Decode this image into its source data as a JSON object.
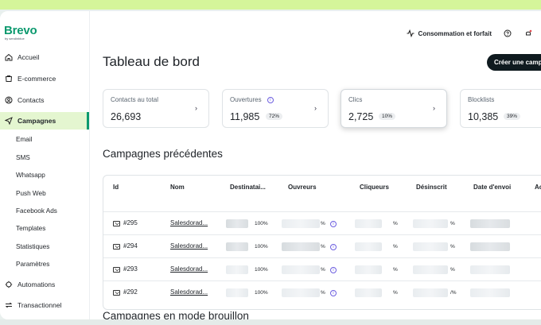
{
  "brand": {
    "name": "Brevo",
    "sub": "by sendinblue"
  },
  "sidebar": {
    "items": [
      {
        "label": "Accueil",
        "icon": "home-icon"
      },
      {
        "label": "E-commerce",
        "icon": "cart-icon"
      },
      {
        "label": "Contacts",
        "icon": "contacts-icon"
      },
      {
        "label": "Campagnes",
        "icon": "send-icon",
        "active": true
      }
    ],
    "subitems": [
      "Email",
      "SMS",
      "Whatsapp",
      "Push Web",
      "Facebook Ads",
      "Templates",
      "Statistiques",
      "Paramètres"
    ],
    "bottom_items": [
      {
        "label": "Automations",
        "icon": "automation-icon"
      },
      {
        "label": "Transactionnel",
        "icon": "transactional-icon"
      }
    ]
  },
  "header": {
    "consumption_label": "Consommation et forfait"
  },
  "page": {
    "title": "Tableau de bord",
    "create_button": "Créer une campagne"
  },
  "stats": [
    {
      "label": "Contacts au total",
      "value": "26,693",
      "badge": ""
    },
    {
      "label": "Ouvertures",
      "value": "11,985",
      "badge": "72%"
    },
    {
      "label": "Clics",
      "value": "2,725",
      "badge": "10%"
    },
    {
      "label": "Blocklists",
      "value": "10,385",
      "badge": "39%"
    }
  ],
  "campaigns": {
    "title": "Campagnes précédentes",
    "columns": [
      "Id",
      "Nom",
      "Destinatai...",
      "Ouvreurs",
      "Cliqueurs",
      "Désinscrit",
      "Date d'envoi",
      "Ac"
    ],
    "rows": [
      {
        "id": "#295",
        "name": "Salesdorad...",
        "dest_pct": "100%",
        "open_pct": "%",
        "click_pct": "%",
        "unsub_pct": "%"
      },
      {
        "id": "#294",
        "name": "Salesdorad...",
        "dest_pct": "100%",
        "open_pct": "%",
        "click_pct": "%",
        "unsub_pct": "%"
      },
      {
        "id": "#293",
        "name": "Salesdorad...",
        "dest_pct": "100%",
        "open_pct": "%",
        "click_pct": "%",
        "unsub_pct": "%"
      },
      {
        "id": "#292",
        "name": "Salesdorad...",
        "dest_pct": "100%",
        "open_pct": "%",
        "click_pct": "%",
        "unsub_pct": "/%"
      }
    ]
  },
  "drafts": {
    "title": "Campagnes en mode brouillon"
  },
  "colors": {
    "brand": "#0b996e",
    "active_bg": "#e4f6d0",
    "top_strip": "#d5f59a",
    "info": "#6d5fe0"
  }
}
